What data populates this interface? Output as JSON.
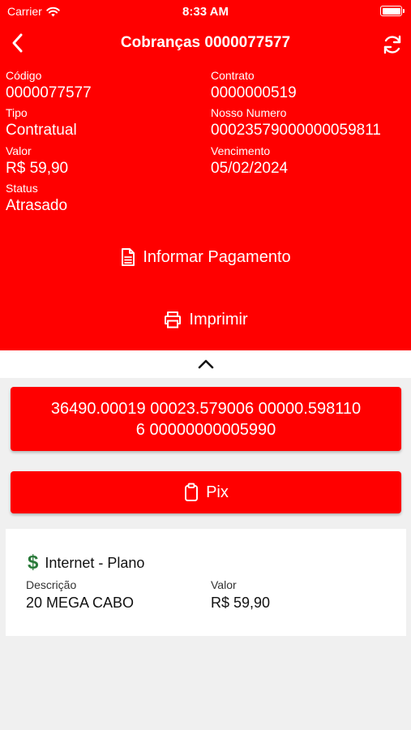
{
  "status_bar": {
    "carrier": "Carrier",
    "time": "8:33 AM"
  },
  "header": {
    "title": "Cobranças 0000077577"
  },
  "details": {
    "codigo_label": "Código",
    "codigo_value": "0000077577",
    "contrato_label": "Contrato",
    "contrato_value": "0000000519",
    "tipo_label": "Tipo",
    "tipo_value": "Contratual",
    "nosso_numero_label": "Nosso Numero",
    "nosso_numero_value": "00023579000000059811",
    "valor_label": "Valor",
    "valor_value": "R$ 59,90",
    "vencimento_label": "Vencimento",
    "vencimento_value": "05/02/2024",
    "status_label": "Status",
    "status_value": "Atrasado"
  },
  "actions": {
    "informar_pagamento": "Informar Pagamento",
    "imprimir": "Imprimir"
  },
  "barcode": {
    "line1": "36490.00019 00023.579006 00000.598110",
    "line2": "6 00000000005990"
  },
  "pix": {
    "label": "Pix"
  },
  "item": {
    "title": "Internet - Plano",
    "descricao_label": "Descrição",
    "descricao_value": "20 MEGA CABO",
    "valor_label": "Valor",
    "valor_value": "R$ 59,90"
  },
  "colors": {
    "primary": "#ff0000",
    "background": "#f0f0f0",
    "card": "#ffffff",
    "dollar_icon": "#2a7a3a"
  },
  "icons": [
    "wifi-icon",
    "battery-icon",
    "back-chevron-icon",
    "refresh-icon",
    "document-icon",
    "printer-icon",
    "chevron-up-icon",
    "clipboard-icon",
    "dollar-icon"
  ]
}
